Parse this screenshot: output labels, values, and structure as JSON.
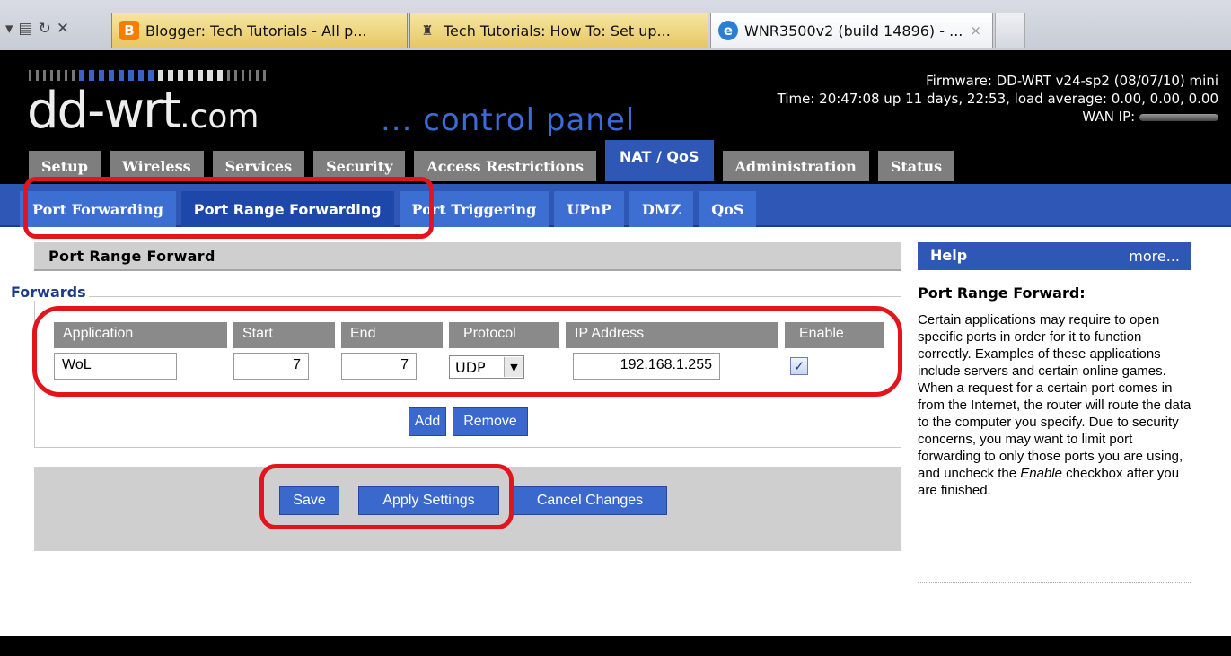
{
  "browser": {
    "tabs": [
      {
        "label": "Blogger: Tech Tutorials - All p...",
        "icon": "blogger-icon"
      },
      {
        "label": "Tech Tutorials: How To: Set up...",
        "icon": "tech-tutorials-icon"
      },
      {
        "label": "WNR3500v2 (build 14896) - ...",
        "icon": "ie-icon",
        "close": "×"
      }
    ]
  },
  "header": {
    "logo": "dd-wrt",
    "logo_suffix": ".com",
    "subtitle": "... control panel",
    "firmware": "Firmware: DD-WRT v24-sp2 (08/07/10) mini",
    "time": "Time: 20:47:08 up 11 days, 22:53, load average: 0.00, 0.00, 0.00",
    "wan_ip_label": "WAN IP:"
  },
  "main_tabs": [
    "Setup",
    "Wireless",
    "Services",
    "Security",
    "Access Restrictions",
    "NAT / QoS",
    "Administration",
    "Status"
  ],
  "sub_tabs": [
    "Port Forwarding",
    "Port Range Forwarding",
    "Port Triggering",
    "UPnP",
    "DMZ",
    "QoS"
  ],
  "section": {
    "title": "Port Range Forward",
    "legend": "Forwards",
    "columns": [
      "Application",
      "Start",
      "End",
      "Protocol",
      "IP Address",
      "Enable"
    ],
    "row": {
      "application": "WoL",
      "start": "7",
      "end": "7",
      "protocol": "UDP",
      "ip": "192.168.1.255",
      "enable": true
    },
    "add_label": "Add",
    "remove_label": "Remove"
  },
  "actions": {
    "save": "Save",
    "apply": "Apply Settings",
    "cancel": "Cancel Changes"
  },
  "help": {
    "header": "Help",
    "more": "more...",
    "title": "Port Range Forward:",
    "text_before": "Certain applications may require to open specific ports in order for it to function correctly. Examples of these applications include servers and certain online games. When a request for a certain port comes in from the Internet, the router will route the data to the computer you specify. Due to security concerns, you may want to limit port forwarding to only those ports you are using, and uncheck the",
    "text_em": "Enable",
    "text_after": "checkbox after you are finished."
  },
  "colors": {
    "accent_blue": "#2f58b6",
    "annotation_red": "#e4141c"
  }
}
